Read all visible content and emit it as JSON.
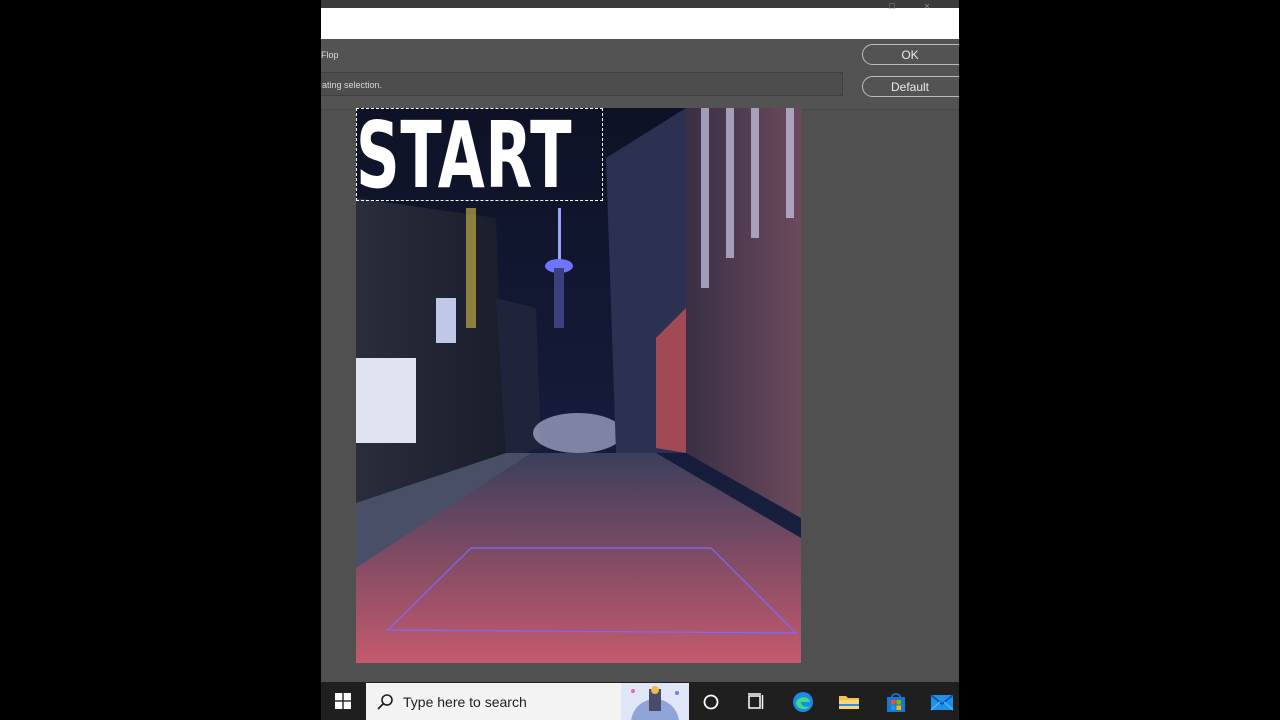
{
  "dialog": {
    "filter_name": "Flop",
    "status": "ating selection.",
    "ok_label": "OK",
    "default_label": "Default"
  },
  "preview": {
    "overlay_text": "START"
  },
  "taskbar": {
    "search_placeholder": "Type here to search",
    "icons": [
      "windows-start-icon",
      "search-icon",
      "cortana-icon",
      "task-view-icon",
      "edge-icon",
      "file-explorer-icon",
      "microsoft-store-icon",
      "mail-icon"
    ]
  },
  "colors": {
    "workspace_bg": "#505050",
    "taskbar_bg": "#1f1f1f",
    "edge_blue": "#1e88e5",
    "folder_yellow": "#f2c14e"
  }
}
